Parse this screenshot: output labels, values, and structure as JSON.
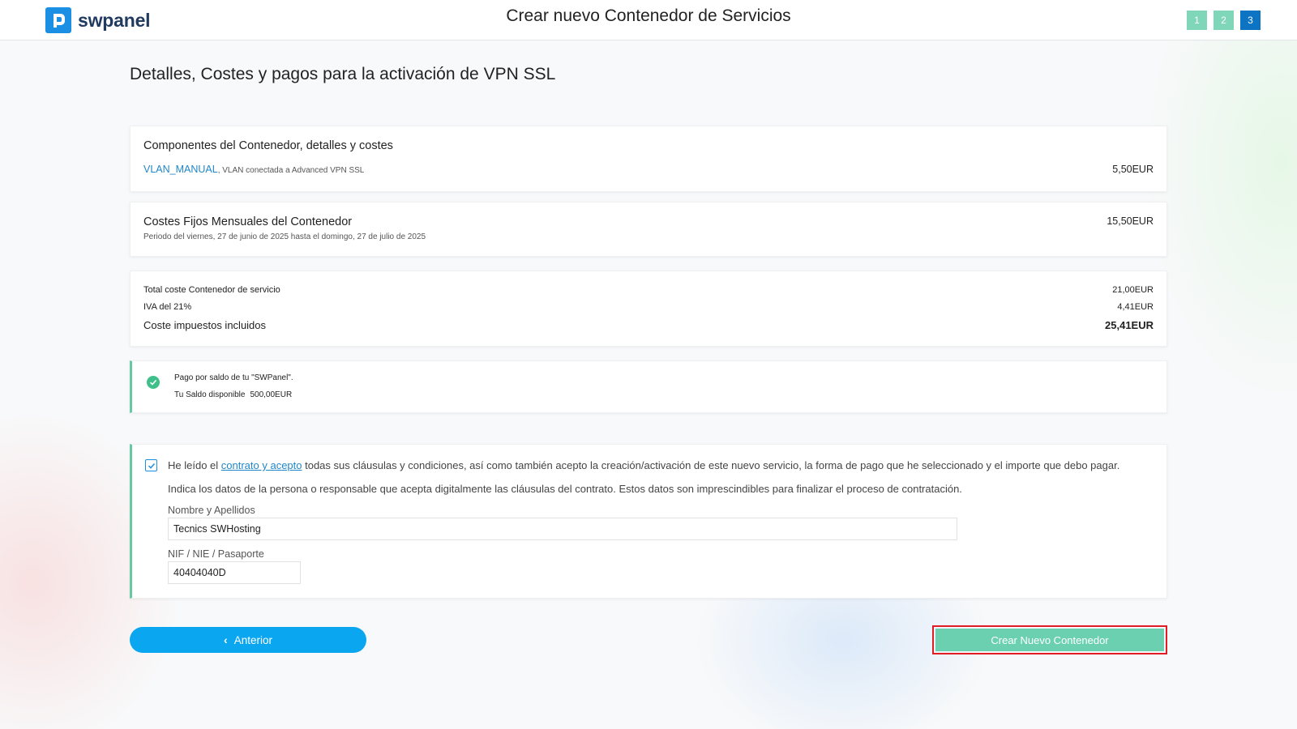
{
  "header": {
    "brand": "swpanel",
    "title": "Crear nuevo Contenedor de Servicios",
    "steps": [
      "1",
      "2",
      "3"
    ]
  },
  "section_title": "Detalles, Costes y pagos para la activación de VPN SSL",
  "components": {
    "title": "Componentes del Contenedor, detalles y costes",
    "item_link": "VLAN_MANUAL",
    "item_desc": ", VLAN conectada a Advanced VPN SSL",
    "item_price": "5,50EUR"
  },
  "fixed_costs": {
    "title": "Costes Fijos Mensuales del Contenedor",
    "period": "Periodo del viernes, 27 de junio de 2025 hasta el domingo, 27 de julio de 2025",
    "price": "15,50EUR"
  },
  "totals": {
    "total_label": "Total coste Contenedor de servicio",
    "total_value": "21,00EUR",
    "iva_label": "IVA del 21%",
    "iva_value": "4,41EUR",
    "tax_incl_label": "Coste impuestos incluidos",
    "tax_incl_value": "25,41EUR"
  },
  "payment": {
    "method": "Pago por saldo de tu \"SWPanel\".",
    "balance_label": "Tu Saldo disponible",
    "balance_value": "500,00EUR"
  },
  "agreement": {
    "prefix": "He leído el ",
    "link": "contrato y acepto",
    "suffix": " todas sus cláusulas y condiciones, así como también acepto la creación/activación de este nuevo servicio, la forma de pago que he seleccionado y el importe que debo pagar.",
    "info": "Indica los datos de la persona o responsable que acepta digitalmente las cláusulas del contrato. Estos datos son imprescindibles para finalizar el proceso de contratación.",
    "checked": true,
    "name_label": "Nombre y Apellidos",
    "name_value": "Tecnics SWHosting",
    "id_label": "NIF / NIE / Pasaporte",
    "id_value": "40404040D"
  },
  "buttons": {
    "previous": "Anterior",
    "create": "Crear Nuevo Contenedor"
  },
  "colors": {
    "brand_blue": "#1a8fe3",
    "step_done": "#7fd6b8",
    "step_active": "#0d74c4",
    "accent_green": "#65c9a3",
    "prev_button": "#0aa6f0",
    "create_button": "#6ad0b0",
    "highlight_red": "#e01c25"
  },
  "icons": {
    "logo": "swpanel-logo-icon",
    "payment_ok": "check-circle-icon",
    "prev_chevron": "chevron-left-icon",
    "checkbox_check": "checkmark-icon"
  }
}
